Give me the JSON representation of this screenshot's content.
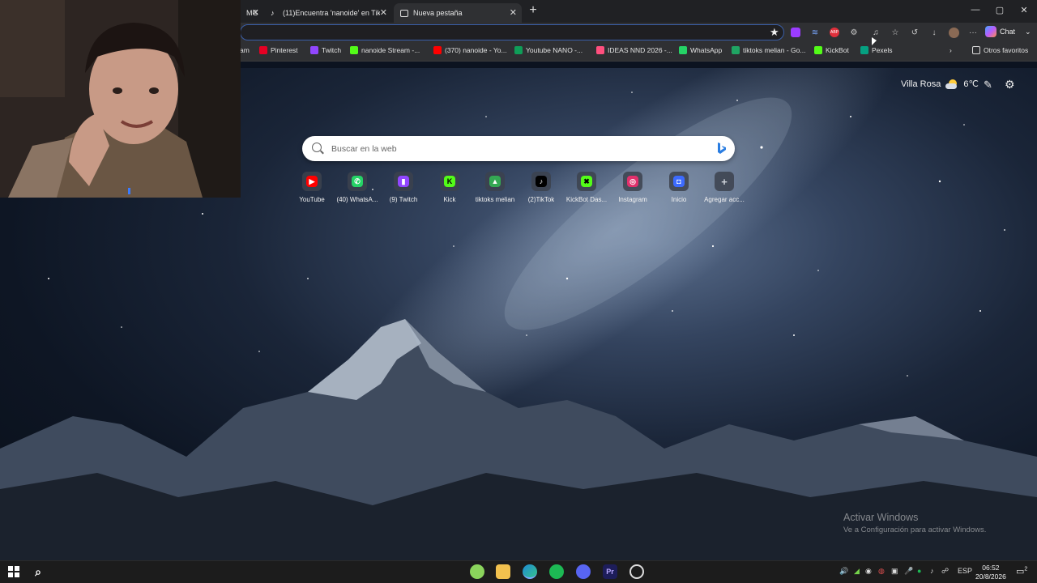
{
  "tabs": [
    {
      "title": "MG",
      "close": "✕"
    },
    {
      "title": "(11)Encuentra 'nanoide' en TikTok",
      "close": "✕"
    },
    {
      "title": "Nueva pestaña",
      "close": "✕"
    }
  ],
  "window_controls": {
    "minimize": "—",
    "maximize": "▢",
    "close": "✕"
  },
  "new_tab_symbol": "+",
  "toolbar": {
    "chat_label": "Chat",
    "more": "···"
  },
  "bookmarks": [
    {
      "label": "am",
      "icon_color": "#2f3033"
    },
    {
      "label": "Pinterest",
      "icon_color": "#e60023"
    },
    {
      "label": "Twitch",
      "icon_color": "#9146ff"
    },
    {
      "label": "nanoide Stream -...",
      "icon_color": "#53fc18"
    },
    {
      "label": "(370) nanoide - Yo...",
      "icon_color": "#ff0000"
    },
    {
      "label": "Youtube NANO -...",
      "icon_color": "#0f9d58"
    },
    {
      "label": "IDEAS NND 2026 -...",
      "icon_color": "#ff4f7e"
    },
    {
      "label": "WhatsApp",
      "icon_color": "#25d366"
    },
    {
      "label": "tiktoks melian - Go...",
      "icon_color": "#1fa463"
    },
    {
      "label": "KickBot",
      "icon_color": "#53fc18"
    },
    {
      "label": "Pexels",
      "icon_color": "#05a081"
    }
  ],
  "bookmarks_more": "›",
  "other_favorites": "Otros favoritos",
  "weather": {
    "location": "Villa Rosa",
    "temp": "6℃"
  },
  "search": {
    "placeholder": "Buscar en la web"
  },
  "quick_links": [
    {
      "label": "YouTube",
      "color": "#ff0000",
      "glyph": "▶"
    },
    {
      "label": "(40) WhatsA...",
      "color": "#25d366",
      "glyph": "✆"
    },
    {
      "label": "(9) Twitch",
      "color": "#9146ff",
      "glyph": "▮"
    },
    {
      "label": "Kick",
      "color": "#53fc18",
      "glyph": "K"
    },
    {
      "label": "tiktoks melian",
      "color": "#34a853",
      "glyph": "▲"
    },
    {
      "label": "(2)TikTok",
      "color": "#000000",
      "glyph": "♪"
    },
    {
      "label": "KickBot Das...",
      "color": "#53fc18",
      "glyph": "✖"
    },
    {
      "label": "Instagram",
      "color": "#e1306c",
      "glyph": "◎"
    },
    {
      "label": "Inicio",
      "color": "#3c6bff",
      "glyph": "◘"
    },
    {
      "label": "Agregar acc...",
      "color": "#5a5f6a",
      "glyph": "+"
    }
  ],
  "activate_windows": {
    "title": "Activar Windows",
    "subtitle": "Ve a Configuración para activar Windows."
  },
  "taskbar": {
    "language": "ESP",
    "time": "06:52",
    "date": "20/8/2026",
    "notification_count": "2"
  }
}
